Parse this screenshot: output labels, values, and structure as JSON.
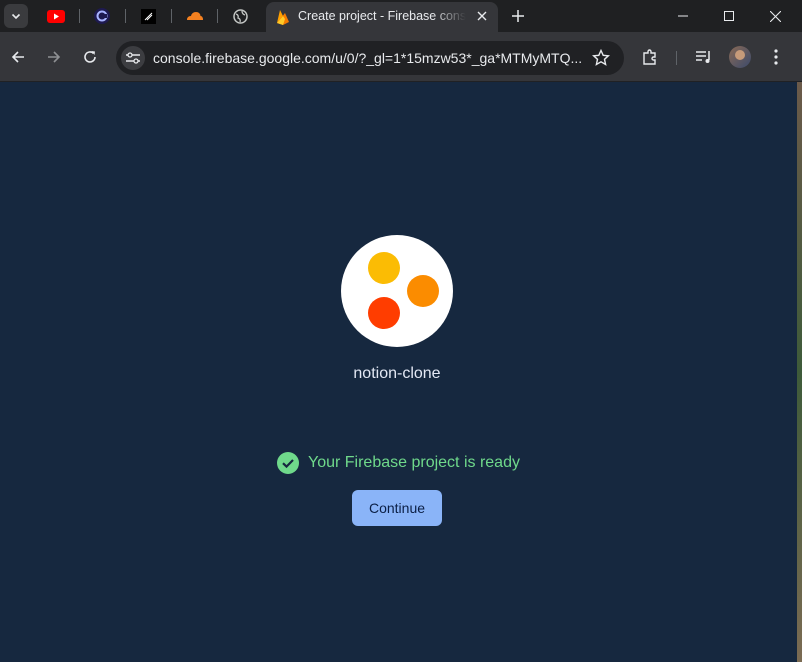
{
  "browser": {
    "pinned_tabs": [
      {
        "icon": "youtube-icon"
      },
      {
        "icon": "copilot-c-icon"
      },
      {
        "icon": "notion-slash-icon"
      },
      {
        "icon": "cloudflare-icon"
      },
      {
        "icon": "globe-icon"
      }
    ],
    "active_tab": {
      "title": "Create project - Firebase console",
      "icon": "firebase-icon"
    },
    "address": {
      "url": "console.firebase.google.com/u/0/?_gl=1*15mzw53*_ga*MTMyMTQ..."
    }
  },
  "page": {
    "project_name": "notion-clone",
    "status_message": "Your Firebase project is ready",
    "continue_label": "Continue",
    "colors": {
      "background": "#16283f",
      "success": "#6fd98b",
      "button": "#8ab4f8",
      "logo_yellow": "#fbbc04",
      "logo_orange": "#fb8c00",
      "logo_red": "#ff3d00"
    }
  }
}
